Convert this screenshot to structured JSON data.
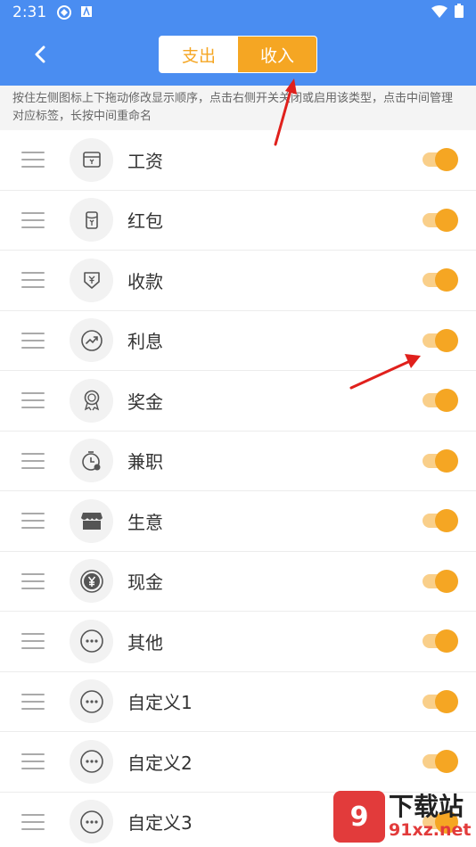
{
  "status_bar": {
    "time": "2:31"
  },
  "header": {
    "tabs": [
      {
        "label": "支出",
        "active": false
      },
      {
        "label": "收入",
        "active": true
      }
    ]
  },
  "hint": "按住左侧图标上下拖动修改显示顺序，点击右侧开关关闭或启用该类型，点击中间管理对应标签，长按中间重命名",
  "categories": [
    {
      "label": "工资",
      "icon": "wallet-icon",
      "enabled": true
    },
    {
      "label": "红包",
      "icon": "red-envelope-icon",
      "enabled": true
    },
    {
      "label": "收款",
      "icon": "receive-money-icon",
      "enabled": true
    },
    {
      "label": "利息",
      "icon": "trend-up-icon",
      "enabled": true
    },
    {
      "label": "奖金",
      "icon": "medal-icon",
      "enabled": true
    },
    {
      "label": "兼职",
      "icon": "clock-icon",
      "enabled": true
    },
    {
      "label": "生意",
      "icon": "shop-icon",
      "enabled": true
    },
    {
      "label": "现金",
      "icon": "yen-coin-icon",
      "enabled": true
    },
    {
      "label": "其他",
      "icon": "more-icon",
      "enabled": true
    },
    {
      "label": "自定义1",
      "icon": "more-icon",
      "enabled": true
    },
    {
      "label": "自定义2",
      "icon": "more-icon",
      "enabled": true
    },
    {
      "label": "自定义3",
      "icon": "more-icon",
      "enabled": true
    }
  ],
  "watermark": {
    "badge": "9",
    "name": "下载站",
    "url": "91xz.net"
  },
  "colors": {
    "header": "#4a8df1",
    "accent": "#f5a623"
  }
}
